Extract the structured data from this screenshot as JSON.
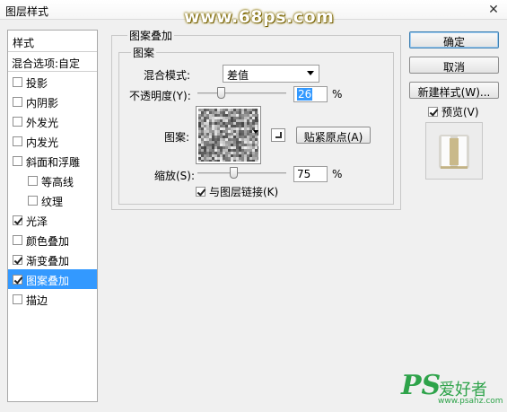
{
  "window": {
    "title": "图层样式",
    "close_glyph": "✕"
  },
  "watermark_top": "www.68ps.com",
  "left_panel": {
    "header": "样式",
    "blend_options": "混合选项:自定",
    "items": [
      {
        "label": "投影",
        "checked": false,
        "indent": false,
        "selected": false
      },
      {
        "label": "内阴影",
        "checked": false,
        "indent": false,
        "selected": false
      },
      {
        "label": "外发光",
        "checked": false,
        "indent": false,
        "selected": false
      },
      {
        "label": "内发光",
        "checked": false,
        "indent": false,
        "selected": false
      },
      {
        "label": "斜面和浮雕",
        "checked": false,
        "indent": false,
        "selected": false
      },
      {
        "label": "等高线",
        "checked": false,
        "indent": true,
        "selected": false
      },
      {
        "label": "纹理",
        "checked": false,
        "indent": true,
        "selected": false
      },
      {
        "label": "光泽",
        "checked": true,
        "indent": false,
        "selected": false
      },
      {
        "label": "颜色叠加",
        "checked": false,
        "indent": false,
        "selected": false
      },
      {
        "label": "渐变叠加",
        "checked": true,
        "indent": false,
        "selected": false
      },
      {
        "label": "图案叠加",
        "checked": true,
        "indent": false,
        "selected": true
      },
      {
        "label": "描边",
        "checked": false,
        "indent": false,
        "selected": false
      }
    ]
  },
  "main": {
    "section_title": "图案叠加",
    "group_title": "图案",
    "blend_mode_label": "混合模式:",
    "blend_mode_value": "差值",
    "opacity_label": "不透明度(Y):",
    "opacity_value": "26",
    "opacity_level": 0.26,
    "percent_sign": "%",
    "pattern_label": "图案:",
    "snap_origin_label": "贴紧原点(A)",
    "scale_label": "缩放(S):",
    "scale_value": "75",
    "scale_level": 0.75,
    "link_label": "与图层链接(K)",
    "link_checked": true
  },
  "right_panel": {
    "ok_label": "确定",
    "cancel_label": "取消",
    "new_style_label": "新建样式(W)...",
    "preview_label": "预览(V)",
    "preview_checked": true
  },
  "watermark_bottom": {
    "logo": "PS",
    "text": "爱好者",
    "url": "www.psahz.com"
  },
  "colors": {
    "selection": "#3399ff",
    "watermark_green": "#2ea34a"
  }
}
